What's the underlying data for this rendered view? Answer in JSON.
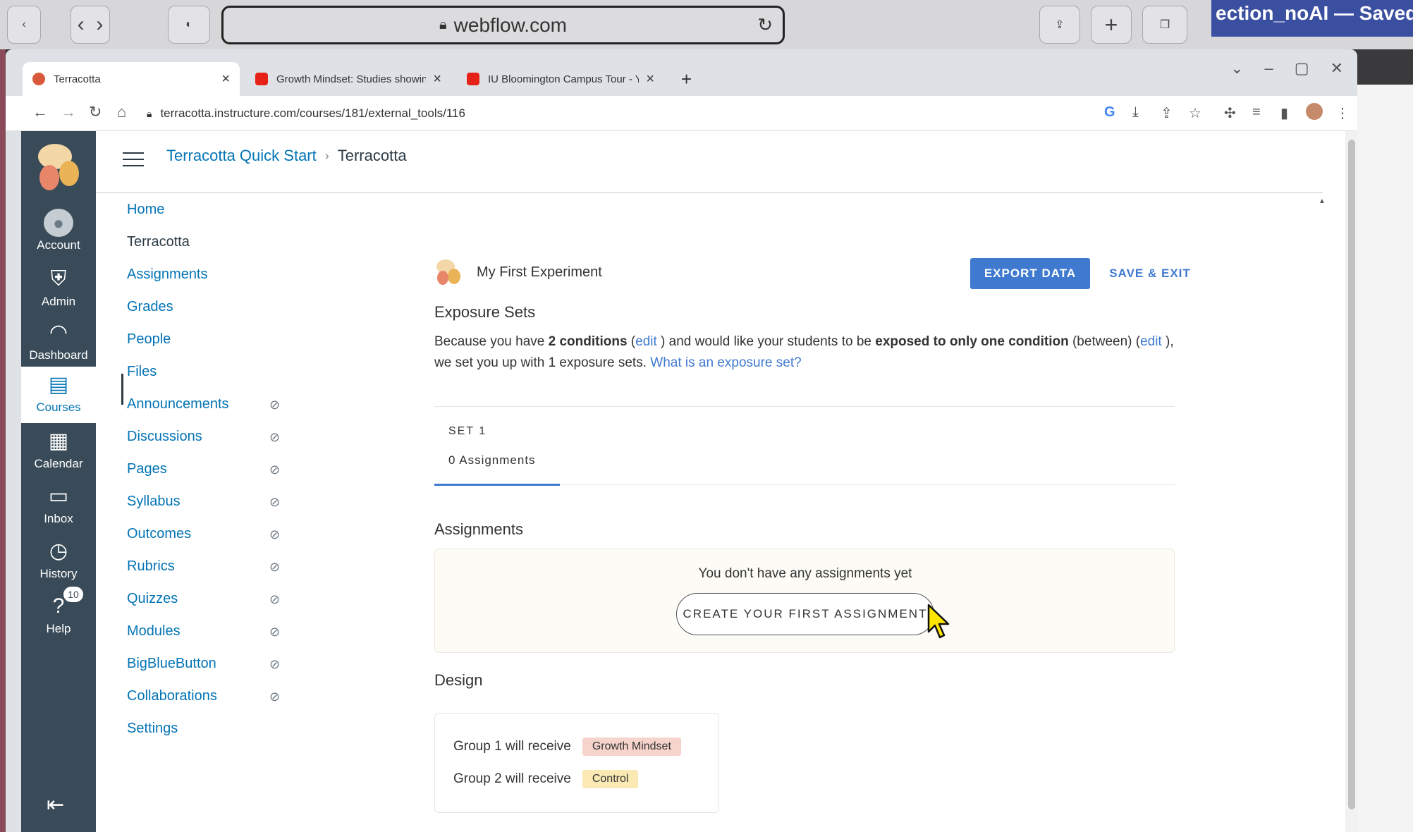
{
  "safari": {
    "url": "webflow.com",
    "doc_title": "ection_noAI — Saved to"
  },
  "chrome": {
    "tabs": [
      {
        "title": "Terracotta",
        "active": true
      },
      {
        "title": "Growth Mindset: Studies showing",
        "active": false
      },
      {
        "title": "IU Bloomington Campus Tour - Y",
        "active": false
      }
    ],
    "new_tab": "+",
    "url": "terracotta.instructure.com/courses/181/external_tools/116"
  },
  "global_nav": {
    "items": [
      {
        "label": "Account",
        "icon": "account-icon",
        "glyph": "●"
      },
      {
        "label": "Admin",
        "icon": "shield-icon",
        "glyph": "⛨"
      },
      {
        "label": "Dashboard",
        "icon": "dashboard-icon",
        "glyph": "◠"
      },
      {
        "label": "Courses",
        "icon": "courses-icon",
        "glyph": "▤"
      },
      {
        "label": "Calendar",
        "icon": "calendar-icon",
        "glyph": "▦"
      },
      {
        "label": "Inbox",
        "icon": "inbox-icon",
        "glyph": "▭"
      },
      {
        "label": "History",
        "icon": "history-icon",
        "glyph": "◷"
      },
      {
        "label": "Help",
        "icon": "help-icon",
        "glyph": "?",
        "badge": "10"
      }
    ],
    "active": "Courses",
    "collapse_glyph": "⇤"
  },
  "breadcrumb": {
    "course": "Terracotta Quick Start",
    "separator": "›",
    "tool": "Terracotta"
  },
  "course_nav": {
    "items": [
      {
        "label": "Home",
        "hidden": false
      },
      {
        "label": "Terracotta",
        "hidden": false,
        "active": true
      },
      {
        "label": "Assignments",
        "hidden": false
      },
      {
        "label": "Grades",
        "hidden": false
      },
      {
        "label": "People",
        "hidden": false
      },
      {
        "label": "Files",
        "hidden": false
      },
      {
        "label": "Announcements",
        "hidden": true
      },
      {
        "label": "Discussions",
        "hidden": true
      },
      {
        "label": "Pages",
        "hidden": true
      },
      {
        "label": "Syllabus",
        "hidden": true
      },
      {
        "label": "Outcomes",
        "hidden": true
      },
      {
        "label": "Rubrics",
        "hidden": true
      },
      {
        "label": "Quizzes",
        "hidden": true
      },
      {
        "label": "Modules",
        "hidden": true
      },
      {
        "label": "BigBlueButton",
        "hidden": true
      },
      {
        "label": "Collaborations",
        "hidden": true
      },
      {
        "label": "Settings",
        "hidden": false
      }
    ]
  },
  "experiment": {
    "title": "My First Experiment",
    "export_label": "EXPORT DATA",
    "save_label": "SAVE & EXIT"
  },
  "exposure": {
    "heading": "Exposure Sets",
    "p1": "Because you have ",
    "b1": "2 conditions",
    "p2": " (",
    "edit1": "edit",
    "p3": " ) and would like your students to be ",
    "b2": "exposed to only one condition",
    "p4": " (between) (",
    "edit2": "edit",
    "p5": " ), we set you up with 1 exposure sets. ",
    "link": "What is an exposure set?",
    "set_label": "SET 1",
    "set_count": "0 Assignments"
  },
  "assignments": {
    "heading": "Assignments",
    "empty": "You don't have any assignments yet",
    "create_label": "CREATE YOUR FIRST ASSIGNMENT"
  },
  "design": {
    "heading": "Design",
    "groups": [
      {
        "text": "Group 1 will receive",
        "condition": "Growth Mindset",
        "color": "#f6d4cc"
      },
      {
        "text": "Group 2 will receive",
        "condition": "Control",
        "color": "#fbe9b4"
      }
    ]
  },
  "colors": {
    "canvas_nav": "#394b58",
    "link": "#0374b5",
    "primary": "#3f7ad0"
  }
}
